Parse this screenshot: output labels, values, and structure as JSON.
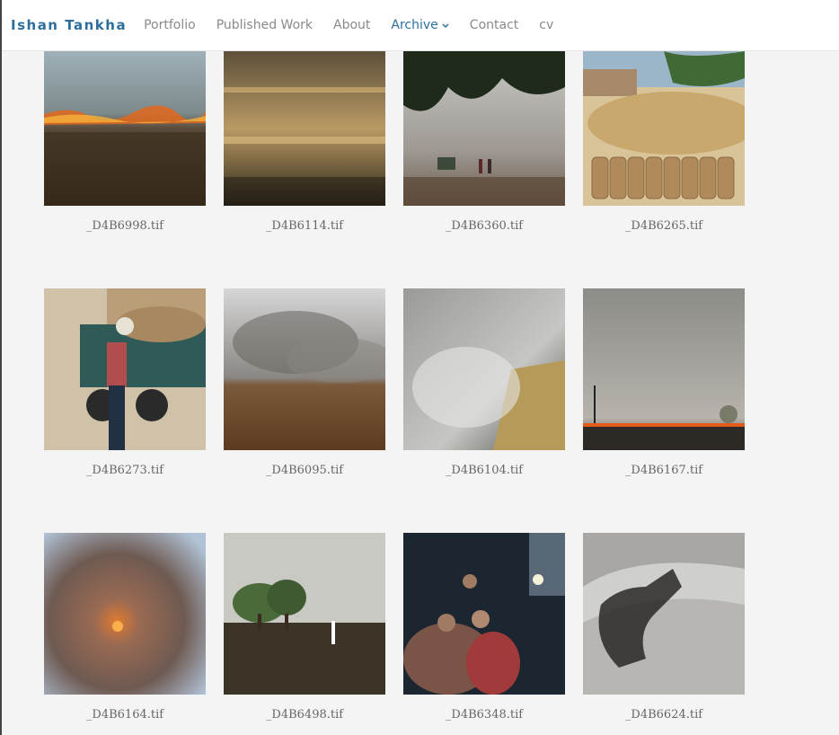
{
  "brand": "Ishan Tankha",
  "nav": {
    "portfolio": "Portfolio",
    "published": "Published Work",
    "about": "About",
    "archive": "Archive",
    "contact": "Contact",
    "cv": "cv"
  },
  "colors": {
    "brand": "#2d6e9e",
    "nav_text": "#8a8a8a",
    "page_bg": "#f4f4f4"
  },
  "gallery": [
    {
      "caption": "_D4B6998.tif"
    },
    {
      "caption": "_D4B6114.tif"
    },
    {
      "caption": "_D4B6360.tif"
    },
    {
      "caption": "_D4B6265.tif"
    },
    {
      "caption": "_D4B6273.tif"
    },
    {
      "caption": "_D4B6095.tif"
    },
    {
      "caption": "_D4B6104.tif"
    },
    {
      "caption": "_D4B6167.tif"
    },
    {
      "caption": "_D4B6164.tif"
    },
    {
      "caption": "_D4B6498.tif"
    },
    {
      "caption": "_D4B6348.tif"
    },
    {
      "caption": "_D4B6624.tif"
    }
  ]
}
